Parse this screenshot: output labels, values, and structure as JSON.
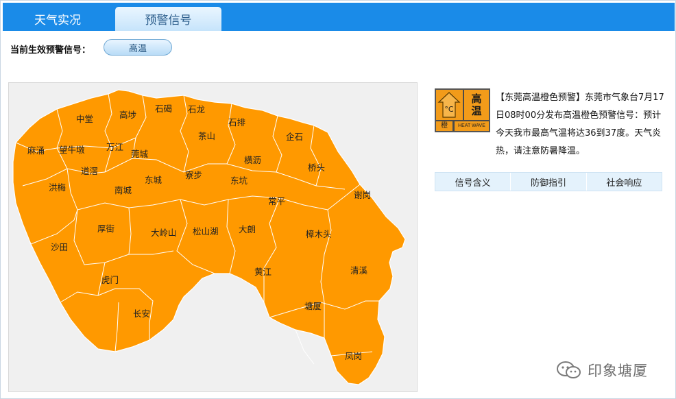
{
  "tabs": [
    {
      "label": "天气实况"
    },
    {
      "label": "预警信号"
    }
  ],
  "current_signal": {
    "label": "当前生效预警信号：",
    "value": "高温"
  },
  "map": {
    "fill_color": "#ff9900",
    "border_color": "#ffffff",
    "towns": [
      "中堂",
      "高埗",
      "石碣",
      "石龙",
      "石排",
      "麻涌",
      "望牛墩",
      "万江",
      "莞城",
      "茶山",
      "企石",
      "道滘",
      "洪梅",
      "南城",
      "东城",
      "寮步",
      "横沥",
      "桥头",
      "东坑",
      "常平",
      "谢岗",
      "厚街",
      "大岭山",
      "松山湖",
      "大朗",
      "樟木头",
      "沙田",
      "虎门",
      "黄江",
      "清溪",
      "长安",
      "塘厦",
      "凤岗"
    ]
  },
  "warning": {
    "icon": {
      "name": "heat-orange-warning-icon",
      "title_chars": [
        "高",
        "温"
      ],
      "thermometer_symbol": "°C",
      "level_text": "橙",
      "english_text": "HEAT WAVE",
      "color": "#f29b1a"
    },
    "text": "【东莞高温橙色预警】东莞市气象台7月17日08时00分发布高温橙色预警信号：预计今天我市最高气温将达36到37度。天气炎热，请注意防暑降温。"
  },
  "info_tabs": [
    "信号含义",
    "防御指引",
    "社会响应"
  ],
  "watermark": {
    "text": "印象塘厦",
    "icon": "wechat-icon"
  }
}
